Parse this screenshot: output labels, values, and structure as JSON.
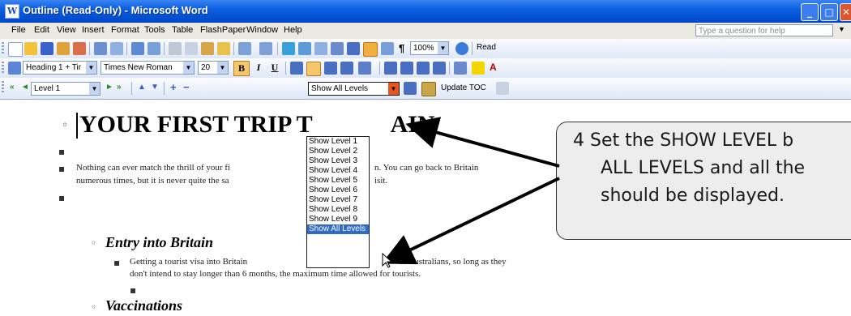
{
  "window": {
    "title": "Outline (Read-Only) - Microsoft Word",
    "app_icon": "word-icon",
    "controls": [
      "minimize",
      "maximize",
      "close"
    ]
  },
  "menu": {
    "items": [
      "File",
      "Edit",
      "View",
      "Insert",
      "Format",
      "Tools",
      "Table",
      "FlashPaper",
      "Window",
      "Help"
    ],
    "help_placeholder": "Type a question for help"
  },
  "standard_toolbar": {
    "zoom": "100%",
    "read_label": "Read"
  },
  "formatting_toolbar": {
    "style": "Heading 1 + Tir",
    "font": "Times New Roman",
    "size": "20",
    "bold": "B",
    "italic": "I",
    "underline": "U",
    "highlight_color": "#f2d600",
    "font_color": "#c00000"
  },
  "outlining_toolbar": {
    "level": "Level 1",
    "show_level": "Show All Levels",
    "update_toc": "Update TOC"
  },
  "dropdown": {
    "options": [
      "Show Level 1",
      "Show Level 2",
      "Show Level 3",
      "Show Level 4",
      "Show Level 5",
      "Show Level 6",
      "Show Level 7",
      "Show Level 8",
      "Show Level 9",
      "Show All Levels"
    ],
    "selected": "Show All Levels"
  },
  "document": {
    "heading1": "YOUR FIRST TRIP T",
    "heading1_tail": "AIN",
    "para1_line1_a": "Nothing can ever match the thrill of your fi",
    "para1_line1_b": "n.  You can go back to Britain",
    "para1_line2_a": "numerous times, but it is never quite the sa",
    "para1_line2_b": "isit.",
    "heading2a": "Entry into Britain",
    "para2_line1_a": "Getting a tourist visa into Britain",
    "para2_line1_b": "or Australians, so long as they",
    "para2_line2": "don't intend to stay longer than 6 months, the maximum time allowed for tourists.",
    "heading2b": "Vaccinations"
  },
  "callout": {
    "lines": [
      "4  Set the SHOW LEVEL b",
      "ALL LEVELS and all the",
      "should be displayed."
    ],
    "background": "#ededed"
  }
}
